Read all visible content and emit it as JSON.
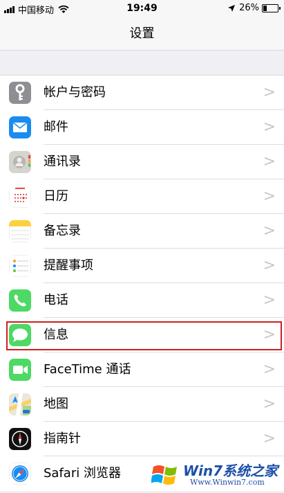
{
  "status_bar": {
    "carrier": "中国移动",
    "time": "19:49",
    "battery_percent": "26%",
    "battery_level": 0.26
  },
  "navbar": {
    "title": "设置"
  },
  "rows": [
    {
      "label": "帐户与密码",
      "icon": "key-icon"
    },
    {
      "label": "邮件",
      "icon": "mail-icon"
    },
    {
      "label": "通讯录",
      "icon": "contacts-icon"
    },
    {
      "label": "日历",
      "icon": "calendar-icon"
    },
    {
      "label": "备忘录",
      "icon": "notes-icon"
    },
    {
      "label": "提醒事项",
      "icon": "reminders-icon"
    },
    {
      "label": "电话",
      "icon": "phone-icon"
    },
    {
      "label": "信息",
      "icon": "messages-icon"
    },
    {
      "label": "FaceTime 通话",
      "icon": "facetime-icon"
    },
    {
      "label": "地图",
      "icon": "maps-icon"
    },
    {
      "label": "指南针",
      "icon": "compass-icon"
    },
    {
      "label": "Safari 浏览器",
      "icon": "safari-icon"
    }
  ],
  "chevron": ">",
  "watermark": {
    "title": "Win7系统之家",
    "url": "Www.Winwin7.com"
  },
  "colors": {
    "highlight": "#cc1f1f",
    "accent_green": "#4cd964"
  }
}
